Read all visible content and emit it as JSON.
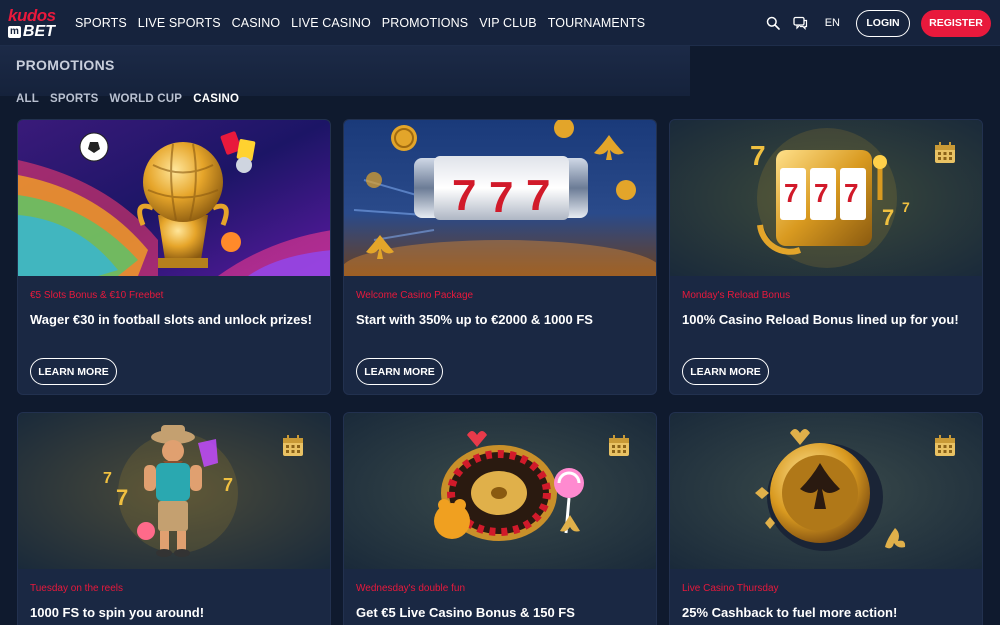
{
  "brand": {
    "logo_top": "kudos",
    "logo_box": "m",
    "logo_bottom": "BET"
  },
  "nav": {
    "items": [
      "SPORTS",
      "LIVE SPORTS",
      "CASINO",
      "LIVE CASINO",
      "PROMOTIONS",
      "VIP CLUB",
      "TOURNAMENTS"
    ]
  },
  "header": {
    "lang": "EN",
    "login_label": "LOGIN",
    "register_label": "REGISTER",
    "icons": [
      "search-icon",
      "chat-icon"
    ]
  },
  "page": {
    "title": "PROMOTIONS",
    "filters": [
      "ALL",
      "SPORTS",
      "WORLD CUP",
      "CASINO"
    ],
    "active_filter": "CASINO"
  },
  "colors": {
    "accent": "#e8193c",
    "background": "#0f1a2e",
    "card": "#1a2843",
    "header": "#16233d"
  },
  "cards": [
    {
      "subtitle": "€5 Slots Bonus & €10 Freebet",
      "title": "Wager €30 in football slots and unlock prizes!",
      "button": "LEARN MORE",
      "image": "golden-football-trophy"
    },
    {
      "subtitle": "Welcome Casino Package",
      "title": "Start with 350% up to €2000 & 1000 FS",
      "button": "LEARN MORE",
      "image": "777-slot-reel"
    },
    {
      "subtitle": "Monday's Reload Bonus",
      "title": "100% Casino Reload Bonus lined up for you!",
      "button": "LEARN MORE",
      "image": "golden-slot-machine"
    },
    {
      "subtitle": "Tuesday on the reels",
      "title": "1000 FS to spin you around!",
      "image": "cowboy-character"
    },
    {
      "subtitle": "Wednesday's double fun",
      "title": "Get €5 Live Casino Bonus & 150 FS",
      "image": "roulette-wheel"
    },
    {
      "subtitle": "Live Casino Thursday",
      "title": "25% Cashback to fuel more action!",
      "image": "golden-spade-chip"
    }
  ]
}
